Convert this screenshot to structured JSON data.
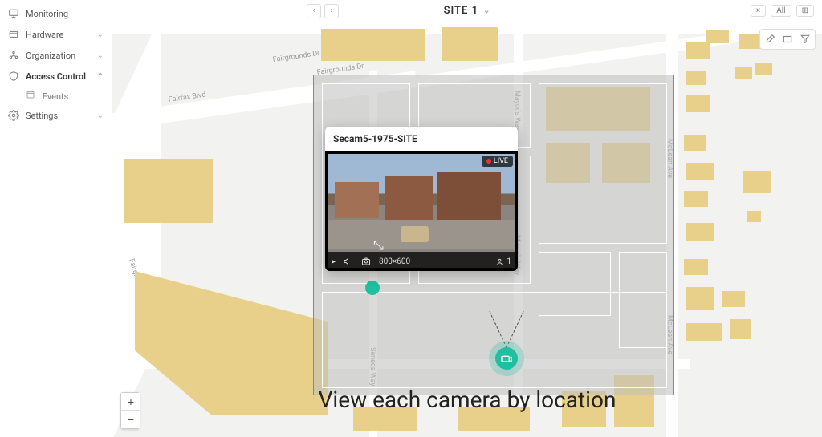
{
  "sidebar": {
    "items": [
      {
        "label": "Monitoring",
        "icon": "monitor",
        "expandable": false
      },
      {
        "label": "Hardware",
        "icon": "hardware",
        "expandable": true
      },
      {
        "label": "Organization",
        "icon": "org",
        "expandable": true
      },
      {
        "label": "Access Control",
        "icon": "shield",
        "expandable": true,
        "expanded": true,
        "children": [
          {
            "label": "Events",
            "icon": "calendar"
          }
        ]
      },
      {
        "label": "Settings",
        "icon": "gear",
        "expandable": true
      }
    ]
  },
  "topbar": {
    "site_label": "SITE 1",
    "filter_all": "All",
    "close_tip": "×"
  },
  "camera_popup": {
    "title": "Secam5-1975-SITE",
    "live_badge": "LIVE",
    "resolution": "800×600",
    "people_count": "1"
  },
  "map": {
    "streets": {
      "fairfax_blvd": "Fairfax Blvd",
      "fairgrounds_dr": "Fairgrounds Dr",
      "mayors_way": "Mayor's Way",
      "mclean_ave": "McLean Ave",
      "seneca_way": "Seneca Way"
    }
  },
  "caption": "View each camera by location",
  "zoom": {
    "in": "+",
    "out": "−"
  },
  "colors": {
    "building": "#e8d08b",
    "accent": "#1fbfa0",
    "road": "#ffffff",
    "map_bg": "#f2f2f0"
  }
}
